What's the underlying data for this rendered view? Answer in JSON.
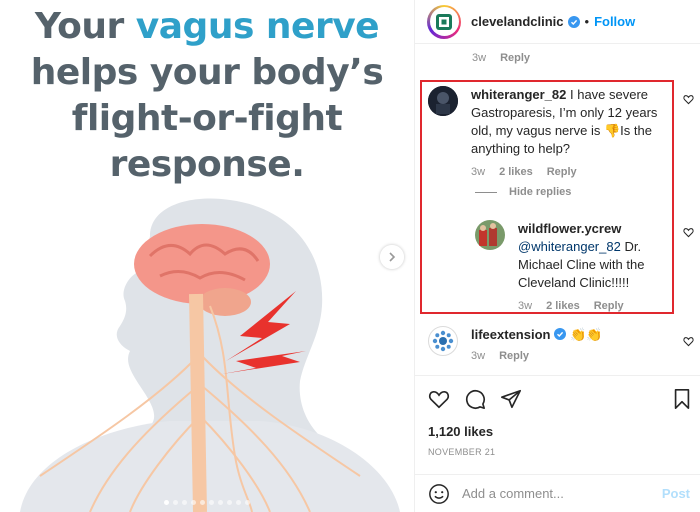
{
  "post": {
    "headline_line1_a": "Your ",
    "headline_line1_b": "vagus nerve",
    "headline_line2": "helps your body’s",
    "headline_line3": "flight-or-fight",
    "headline_line4": "response.",
    "next_icon": "chevron-right-icon",
    "accent_color": "#2fa0c9",
    "text_color": "#55626b"
  },
  "header": {
    "username": "clevelandclinic",
    "separator": "•",
    "follow_label": "Follow"
  },
  "top_meta": {
    "time": "3w",
    "reply": "Reply"
  },
  "comment1": {
    "username": "whiteranger_82",
    "text": " I have severe Gastroparesis, I’m only 12 years old, my vagus nerve is 👎Is the anything to help?",
    "time": "3w",
    "likes": "2 likes",
    "reply": "Reply",
    "hide_replies": "Hide replies"
  },
  "reply1": {
    "username": "wildflower.ycrew",
    "mention": "@whiteranger_82",
    "text": " Dr. Michael Cline with the Cleveland Clinic!!!!!",
    "time": "3w",
    "likes": "2 likes",
    "reply": "Reply"
  },
  "comment2": {
    "username": "lifeextension",
    "text": " 👏👏",
    "time": "3w",
    "reply": "Reply"
  },
  "actions": {
    "likes": "1,120 likes",
    "date": "NOVEMBER 21"
  },
  "add_comment": {
    "placeholder": "Add a comment...",
    "post_label": "Post"
  },
  "colors": {
    "link": "#0095f6",
    "highlight_border": "#e0282e"
  }
}
